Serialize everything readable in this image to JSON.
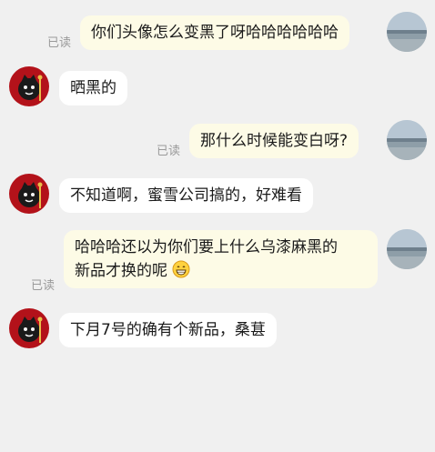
{
  "read_label": "已读",
  "messages": [
    {
      "sender": "me",
      "text": "你们头像怎么变黑了呀哈哈哈哈哈哈",
      "read": "已读"
    },
    {
      "sender": "other",
      "text": "晒黑的"
    },
    {
      "sender": "me",
      "text": "那什么时候能变白呀?",
      "read": "已读"
    },
    {
      "sender": "other",
      "text": "不知道啊，蜜雪公司搞的，好难看"
    },
    {
      "sender": "me",
      "line1": "哈哈哈还以为你们要上什么乌漆麻黑的",
      "line2": "新品才换的呢",
      "emoji": "grinning-emoji",
      "read": "已读"
    },
    {
      "sender": "other",
      "text": "下月7号的确有个新品，桑葚"
    }
  ],
  "colors": {
    "background": "#f0f0f0",
    "my_bubble": "#fdfbe6",
    "other_bubble": "#ffffff",
    "read_text": "#9a9a9a",
    "other_avatar": "#b3121a"
  }
}
